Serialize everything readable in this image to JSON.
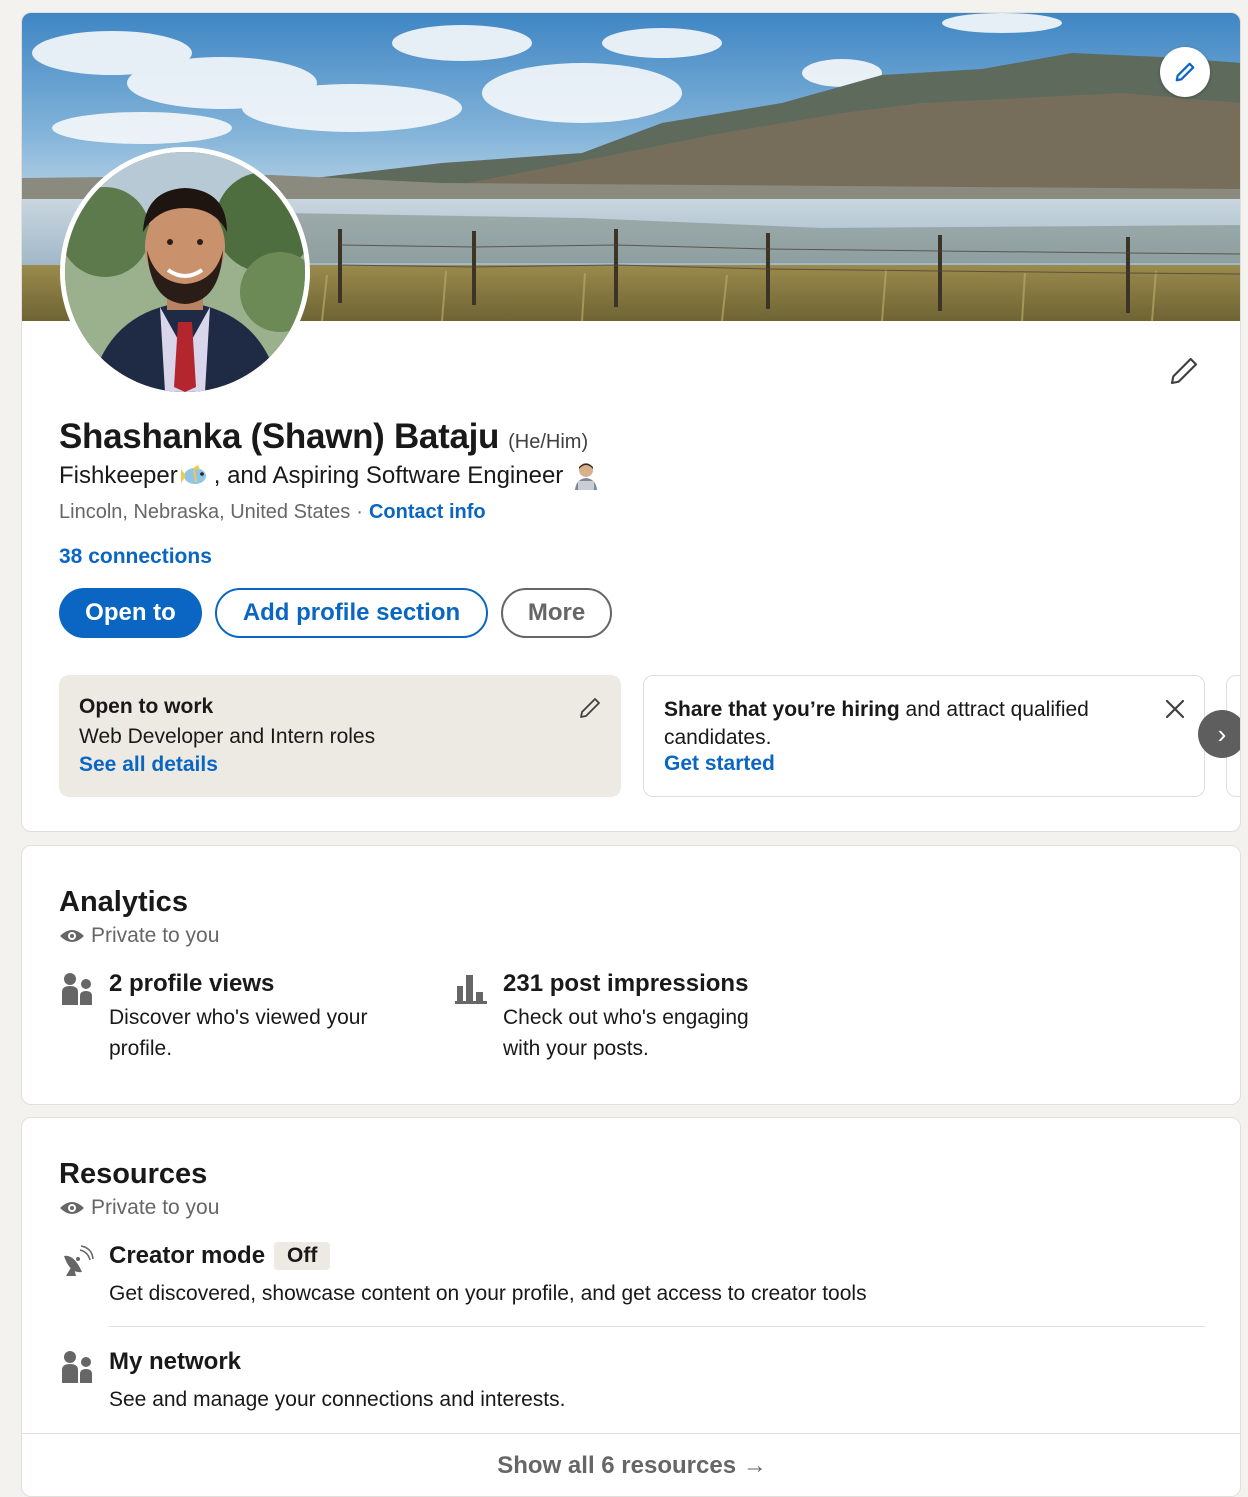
{
  "profile": {
    "name": "Shashanka (Shawn) Bataju",
    "pronouns": "(He/Him)",
    "headline_part1": "Fishkeeper",
    "headline_part2": ", and Aspiring Software Engineer",
    "location": "Lincoln, Nebraska, United States",
    "location_separator": "·",
    "contact_info": "Contact info",
    "connections": "38 connections"
  },
  "actions": {
    "open_to": "Open to",
    "add_profile_section": "Add profile section",
    "more": "More"
  },
  "open_to_work": {
    "title": "Open to work",
    "roles": "Web Developer and Intern roles",
    "link": "See all details"
  },
  "hiring": {
    "bold": "Share that you’re hiring",
    "rest": " and attract qualified candidates.",
    "link": "Get started"
  },
  "carousel": {
    "next_glyph": "›"
  },
  "analytics": {
    "title": "Analytics",
    "private": "Private to you",
    "stats": [
      {
        "title": "2 profile views",
        "desc_line1": "Discover who's viewed your",
        "desc_line2": "profile.",
        "icon": "people-icon"
      },
      {
        "title": "231 post impressions",
        "desc_line1": "Check out who's engaging",
        "desc_line2": "with your posts.",
        "icon": "bar-chart-icon"
      }
    ]
  },
  "resources": {
    "title": "Resources",
    "private": "Private to you",
    "items": [
      {
        "title": "Creator mode",
        "badge": "Off",
        "desc": "Get discovered, showcase content on your profile, and get access to creator tools",
        "icon": "satellite-dish-icon"
      },
      {
        "title": "My network",
        "desc": "See and manage your connections and interests.",
        "icon": "people-icon"
      }
    ],
    "show_all": "Show all 6 resources",
    "show_all_arrow": "→"
  },
  "colors": {
    "brand_blue": "#0a66c2",
    "page_bg": "#f3f2ef",
    "muted_text": "#666666",
    "otw_bg": "#edeae4"
  }
}
